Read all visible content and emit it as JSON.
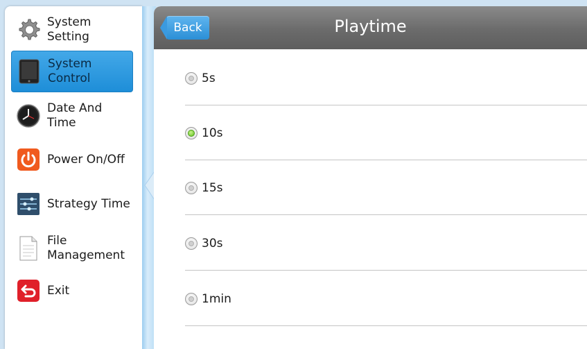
{
  "sidebar": {
    "items": [
      {
        "label": "System Setting",
        "icon": "gear-icon",
        "selected": false
      },
      {
        "label": "System Control",
        "icon": "tablet-icon",
        "selected": true
      },
      {
        "label": "Date And Time",
        "icon": "clock-icon",
        "selected": false
      },
      {
        "label": "Power On/Off",
        "icon": "power-icon",
        "selected": false
      },
      {
        "label": "Strategy Time",
        "icon": "sliders-icon",
        "selected": false
      },
      {
        "label": "File\nManagement",
        "icon": "document-icon",
        "selected": false
      },
      {
        "label": "Exit",
        "icon": "exit-icon",
        "selected": false
      }
    ]
  },
  "header": {
    "back_label": "Back",
    "title": "Playtime"
  },
  "options": [
    {
      "label": "5s",
      "checked": false
    },
    {
      "label": "10s",
      "checked": true
    },
    {
      "label": "15s",
      "checked": false
    },
    {
      "label": "30s",
      "checked": false
    },
    {
      "label": "1min",
      "checked": false
    }
  ],
  "colors": {
    "accent": "#2b8fd6",
    "selected_radio": "#62c21f",
    "header": "#6b6b6b"
  }
}
